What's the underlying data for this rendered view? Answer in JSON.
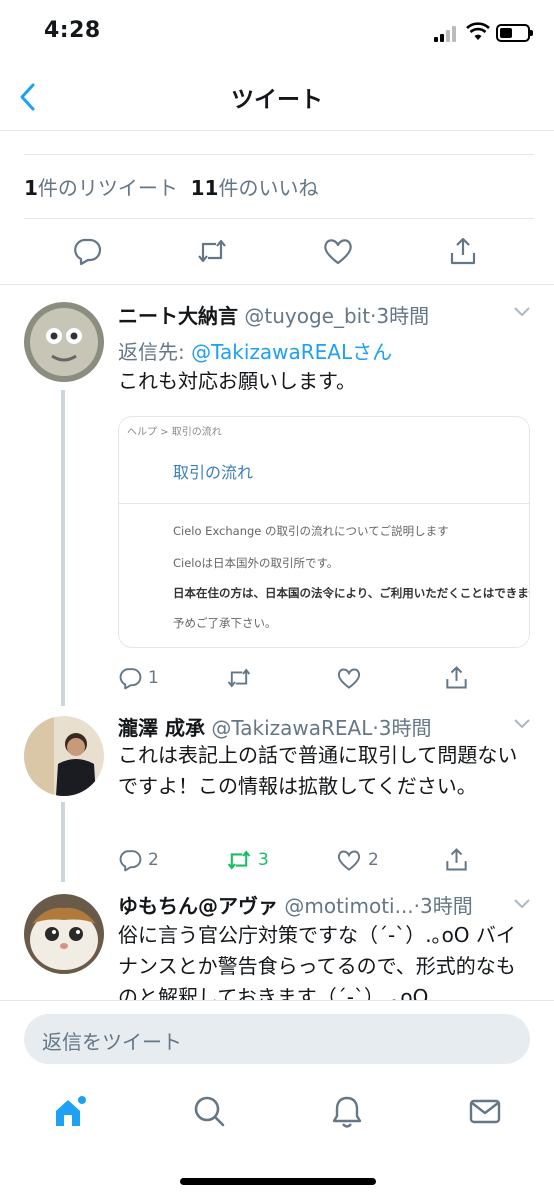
{
  "status_bar": {
    "time": "4:28"
  },
  "nav": {
    "title": "ツイート",
    "back_icon": "chevron-left-icon"
  },
  "stats": {
    "retweets_count": "1",
    "retweets_label": "件のリツイート",
    "likes_count": "11",
    "likes_label": "件のいいね"
  },
  "actions": [
    "reply-icon",
    "retweet-icon",
    "like-icon",
    "share-icon"
  ],
  "replies": [
    {
      "name": "ニート大納言",
      "handle": "@tuyoge_bit",
      "time": "·3時間",
      "reply_to_prefix": "返信先: ",
      "reply_to_user": "@TakizawaREALさん",
      "text": "これも対応お願いします。",
      "counts": {
        "reply": "1",
        "retweet": "",
        "like": ""
      }
    },
    {
      "name": "瀧澤 成承",
      "handle": "@TakizawaREAL",
      "time": "·3時間",
      "text": "これは表記上の話で普通に取引して問題ないですよ！この情報は拡散してください。",
      "counts": {
        "reply": "2",
        "retweet": "3",
        "like": "2"
      }
    },
    {
      "name": "ゆもちん@アヴァ",
      "handle": "@motimoti...",
      "time": "·3時間",
      "text": "俗に言う官公庁対策ですな（´-`）.｡oO バイナンスとか警告食らってるので、形式的なものと解釈しておきます（´-`）.｡oO"
    }
  ],
  "card": {
    "breadcrumb": "ヘルプ > 取引の流れ",
    "title": "取引の流れ",
    "lines": [
      "Cielo Exchange の取引の流れについてご説明します",
      "Cieloは日本国外の取引所です。",
      "日本在住の方は、日本国の法令により、ご利用いただくことはできません",
      "予めご了承下さい。"
    ]
  },
  "compose": {
    "placeholder": "返信をツイート"
  },
  "tabs": [
    "home-icon",
    "search-icon",
    "notifications-icon",
    "messages-icon"
  ],
  "colors": {
    "accent": "#1da1f2",
    "retweet_active": "#17bf63",
    "muted": "#657786"
  }
}
